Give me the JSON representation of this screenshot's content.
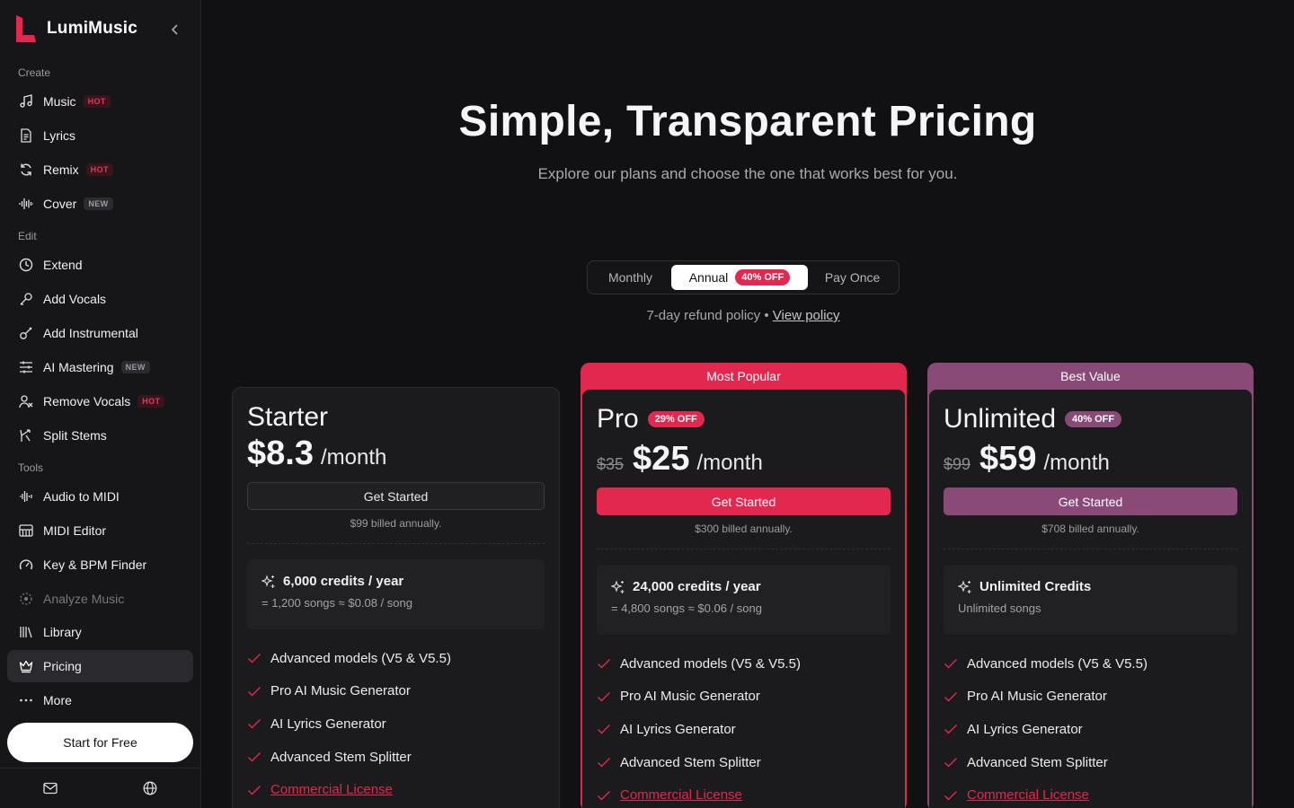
{
  "brand": {
    "name": "LumiMusic"
  },
  "sidebar": {
    "sections": {
      "create": "Create",
      "edit": "Edit",
      "tools": "Tools"
    },
    "items": [
      {
        "label": "Music",
        "tag": "HOT",
        "icon": "music-note-icon"
      },
      {
        "label": "Lyrics",
        "tag": "",
        "icon": "document-icon"
      },
      {
        "label": "Remix",
        "tag": "HOT",
        "icon": "refresh-icon"
      },
      {
        "label": "Cover",
        "tag": "NEW",
        "icon": "waveform-icon"
      },
      {
        "label": "Extend",
        "tag": "",
        "icon": "clock-icon"
      },
      {
        "label": "Add Vocals",
        "tag": "",
        "icon": "microphone-icon"
      },
      {
        "label": "Add Instrumental",
        "tag": "",
        "icon": "guitar-icon"
      },
      {
        "label": "AI Mastering",
        "tag": "NEW",
        "icon": "sliders-icon"
      },
      {
        "label": "Remove Vocals",
        "tag": "HOT",
        "icon": "user-remove-icon"
      },
      {
        "label": "Split Stems",
        "tag": "",
        "icon": "split-icon"
      },
      {
        "label": "Audio to MIDI",
        "tag": "",
        "icon": "audio-wave-icon"
      },
      {
        "label": "MIDI Editor",
        "tag": "",
        "icon": "piano-icon"
      },
      {
        "label": "Key & BPM Finder",
        "tag": "",
        "icon": "gauge-icon"
      },
      {
        "label": "Analyze Music",
        "tag": "",
        "icon": "analyze-icon"
      },
      {
        "label": "Library",
        "tag": "",
        "icon": "library-icon"
      },
      {
        "label": "Pricing",
        "tag": "",
        "icon": "crown-icon"
      },
      {
        "label": "More",
        "tag": "",
        "icon": "more-icon"
      }
    ],
    "start_free": "Start for Free"
  },
  "hero": {
    "title": "Simple, Transparent Pricing",
    "subtitle": "Explore our plans and choose the one that works best for you."
  },
  "billing_toggle": {
    "monthly": "Monthly",
    "annual": "Annual",
    "annual_badge": "40% OFF",
    "pay_once": "Pay Once",
    "selected": "Annual"
  },
  "refund": {
    "text": "7-day refund policy •",
    "link": "View policy"
  },
  "plans": {
    "starter": {
      "name": "Starter",
      "price": "$8.3",
      "per": "/month",
      "cta": "Get Started",
      "billed": "$99 billed annually.",
      "credits": "6,000 credits / year",
      "credits_sub": "= 1,200 songs ≈ $0.08 / song",
      "features": [
        "Advanced models (V5 & V5.5)",
        "Pro AI Music Generator",
        "AI Lyrics Generator",
        "Advanced Stem Splitter",
        "Commercial License"
      ]
    },
    "pro": {
      "ribbon": "Most Popular",
      "name": "Pro",
      "badge": "29% OFF",
      "old_price": "$35",
      "price": "$25",
      "per": "/month",
      "cta": "Get Started",
      "billed": "$300 billed annually.",
      "credits": "24,000 credits / year",
      "credits_sub": "= 4,800 songs ≈ $0.06 / song",
      "features": [
        "Advanced models (V5 & V5.5)",
        "Pro AI Music Generator",
        "AI Lyrics Generator",
        "Advanced Stem Splitter",
        "Commercial License"
      ]
    },
    "unlimited": {
      "ribbon": "Best Value",
      "name": "Unlimited",
      "badge": "40% OFF",
      "old_price": "$99",
      "price": "$59",
      "per": "/month",
      "cta": "Get Started",
      "billed": "$708 billed annually.",
      "credits": "Unlimited Credits",
      "credits_sub": "Unlimited songs",
      "features": [
        "Advanced models (V5 & V5.5)",
        "Pro AI Music Generator",
        "AI Lyrics Generator",
        "Advanced Stem Splitter",
        "Commercial License"
      ]
    }
  },
  "colors": {
    "accent": "#e3284f",
    "best_value": "#8a4a78",
    "background": "#111113",
    "sidebar": "#161618"
  }
}
